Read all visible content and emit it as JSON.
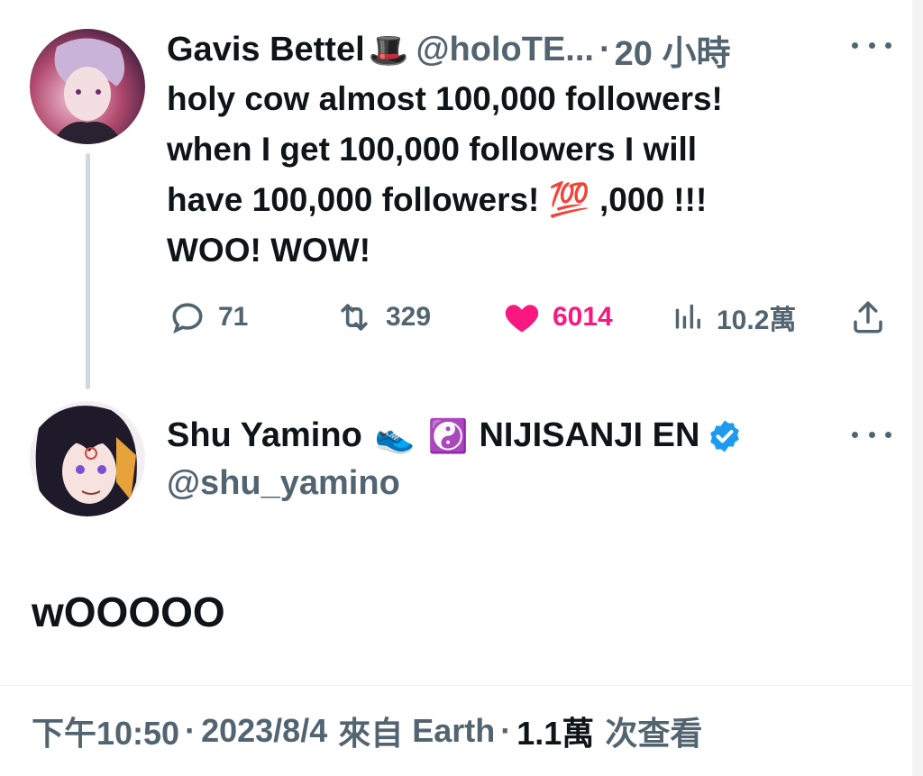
{
  "reply_context": {
    "author": {
      "name": "Gavis Bettel",
      "name_emoji": "🎩",
      "handle": "@holoTE...",
      "separator": "·",
      "time": "20 小時"
    },
    "text_lines": [
      "holy cow almost 100,000 followers!",
      "when I get 100,000 followers I will",
      "have 100,000 followers! 💯 ,000 !!!",
      "WOO! WOW!"
    ],
    "actions": {
      "replies": "71",
      "reposts": "329",
      "likes": "6014",
      "views": "10.2萬"
    },
    "like_color": "#f91880"
  },
  "main_tweet": {
    "author": {
      "name_part1": "Shu Yamino",
      "name_emoji1": "👟",
      "name_emoji2": "☯️",
      "name_part2": "NIJISANJI EN",
      "handle": "@shu_yamino",
      "verified": true,
      "verified_color": "#1d9bf0"
    },
    "text": "wOOOOO",
    "meta": {
      "time": "下午10:50",
      "sep1": "·",
      "date": "2023/8/4",
      "source_prefix": "來自",
      "source": "Earth",
      "sep2": "·",
      "views_count": "1.1萬",
      "views_suffix": "次查看"
    }
  }
}
